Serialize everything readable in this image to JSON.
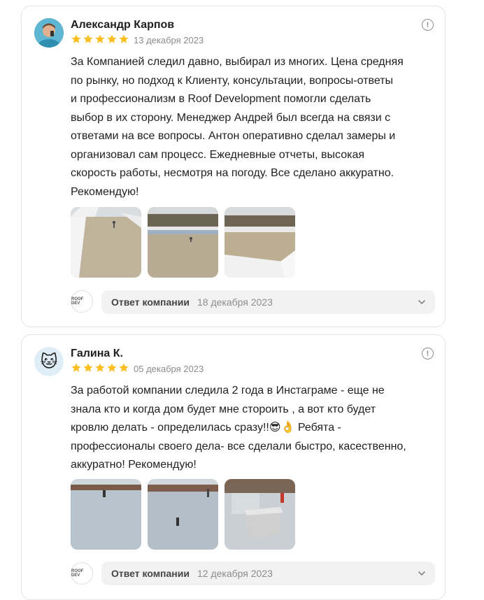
{
  "reviews": [
    {
      "author": "Александр Карпов",
      "rating": 5,
      "date": "13 декабря 2023",
      "text": "За Компанией следил давно, выбирал из многих. Цена средняя\nпо рынку, но подход к Клиенту, консультации, вопросы-ответы\nи профессионализм в Roof Development помогли сделать\nвыбор в их сторону. Менеджер Андрей был всегда на связи с\nответами на все вопросы. Антон оперативно сделал замеры и\nорганизовал сам процесс. Ежедневные отчеты, высокая\nскорость работы, несмотря на погоду. Все сделано аккуратно.\nРекомендую!",
      "reply_label": "Ответ компании",
      "reply_date": "18 декабря 2023"
    },
    {
      "author": "Галина К.",
      "avatar_icon": "cat-emoji-icon",
      "rating": 5,
      "date": "05 декабря 2023",
      "text": "За работой компании следила 2 года в Инстаграме - еще не\nзнала кто и когда дом будет мне стороить , а вот кто будет\nкровлю делать - определилась сразу!!😎👌 Ребята -\nпрофессионалы своего дела- все сделали быстро, касественно,\nаккуратно! Рекомендую!",
      "reply_label": "Ответ компании",
      "reply_date": "12 декабря 2023"
    }
  ],
  "company_logo_text": "ROOF DEV",
  "colors": {
    "star": "#fcbf22",
    "muted": "#8c8c8c",
    "reply_bg": "#f2f2f2"
  }
}
